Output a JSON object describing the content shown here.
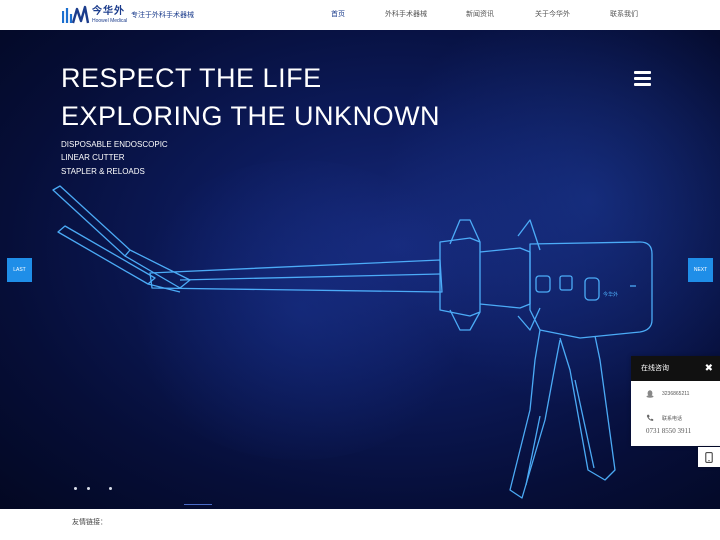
{
  "header": {
    "logo_cn": "今华外",
    "logo_en": "Hoowel Medical",
    "slogan": "专注于外科手术器械",
    "nav": [
      {
        "label": "首页",
        "active": true
      },
      {
        "label": "外科手术器械",
        "active": false
      },
      {
        "label": "新闻资讯",
        "active": false
      },
      {
        "label": "关于今华外",
        "active": false
      },
      {
        "label": "联系我们",
        "active": false
      }
    ]
  },
  "banner": {
    "headline_1": "RESPECT THE LIFE",
    "headline_2": "EXPLORING THE UNKNOWN",
    "sub_1": "DISPOSABLE ENDOSCOPIC",
    "sub_2": "LINEAR CUTTER",
    "sub_3": "STAPLER & RELOADS",
    "prev_label": "LAST",
    "next_label": "NEXT",
    "device_brand": "今华外",
    "slide_count": 3,
    "colors": {
      "accent": "#1f8ee8",
      "outline": "#4fb3ff",
      "bg": "#0c1a5a"
    }
  },
  "footer": {
    "links_label": "友情链接："
  },
  "widget": {
    "title": "在线咨询",
    "qq": "3236865211",
    "phone_label": "联系电话",
    "phone": "0731 8550 3911",
    "icons": [
      "qq-icon",
      "phone-icon",
      "close-icon",
      "mobile-icon"
    ]
  }
}
